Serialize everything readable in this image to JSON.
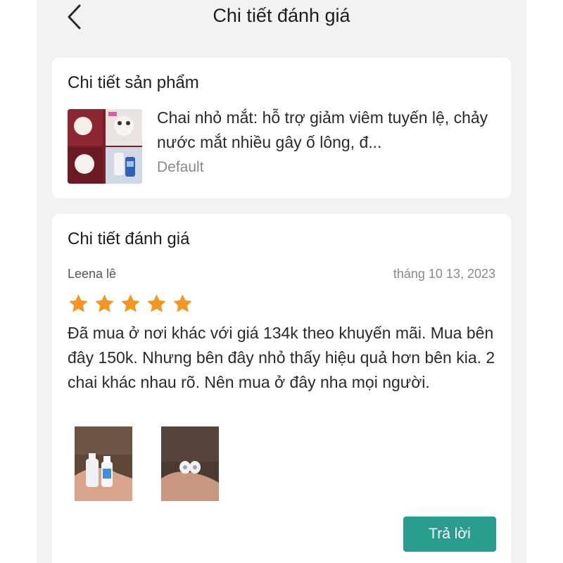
{
  "header": {
    "title": "Chi tiết đánh giá",
    "back_icon": "chevron-left-icon"
  },
  "product_section": {
    "title": "Chi tiết sản phẩm",
    "product_name": "Chai nhỏ mắt: hỗ trợ giảm viêm tuyến lệ, chảy nước mắt nhiều gây ố lông, đ...",
    "variant": "Default"
  },
  "review_section": {
    "title": "Chi tiết đánh giá",
    "reviewer": "Leena lê",
    "date": "tháng 10 13, 2023",
    "rating": 5,
    "rating_max": 5,
    "star_color": "#f5941e",
    "text": "Đã mua ở nơi khác với giá 134k theo khuyến mãi. Mua bên đây 150k. Nhưng bên đây nhỏ thấy hiệu quả hơn bên kia. 2 chai khác nhau rõ. Nên mua ở đây nha mọi người.",
    "reply_label": "Trả lời",
    "accent_color": "#2a9d8f"
  }
}
